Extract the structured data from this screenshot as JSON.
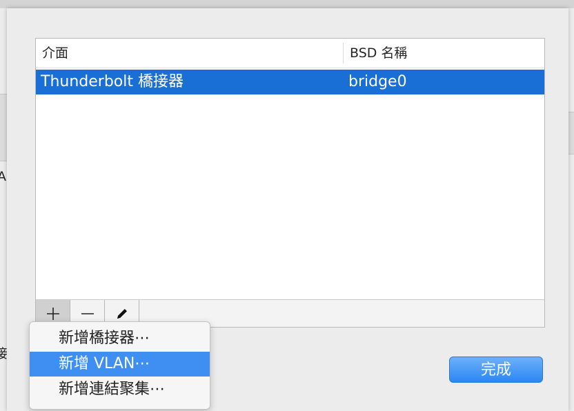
{
  "background": {
    "left_fragment_1": "A",
    "left_fragment_2": "接"
  },
  "table": {
    "headers": [
      "介面",
      "BSD 名稱"
    ],
    "rows": [
      {
        "interface": "Thunderbolt 橋接器",
        "bsd_name": "bridge0",
        "selected": true
      }
    ]
  },
  "toolbar": {
    "add_icon": "plus-icon",
    "remove_icon": "minus-icon",
    "edit_icon": "pencil-icon"
  },
  "menu": {
    "items": [
      {
        "label": "新增橋接器⋯",
        "highlighted": false
      },
      {
        "label": "新增 VLAN⋯",
        "highlighted": true
      },
      {
        "label": "新增連結聚集⋯",
        "highlighted": false
      }
    ]
  },
  "done_label": "完成",
  "colors": {
    "selection": "#1a6fd6",
    "menu_highlight": "#3f8ff2",
    "accent_button": "#2b86f3"
  }
}
